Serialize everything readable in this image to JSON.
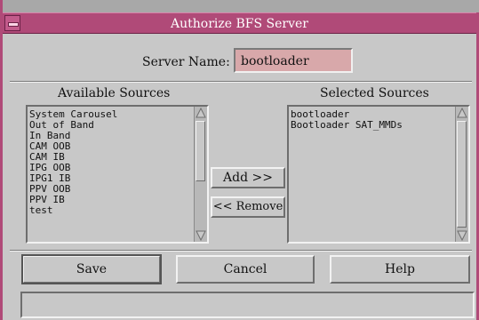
{
  "window": {
    "title": "Authorize BFS Server"
  },
  "server": {
    "label": "Server Name:",
    "value": "bootloader"
  },
  "available": {
    "label": "Available Sources",
    "items": [
      "System Carousel",
      "Out of Band",
      "In Band",
      "CAM OOB",
      "CAM IB",
      "IPG OOB",
      "IPG1 IB",
      "PPV OOB",
      "PPV IB",
      "test"
    ]
  },
  "selected": {
    "label": "Selected Sources",
    "items": [
      "bootloader",
      "Bootloader SAT_MMDs"
    ]
  },
  "transfer": {
    "add_label": "Add >>",
    "remove_label": "<< Remove"
  },
  "actions": {
    "save_label": "Save",
    "cancel_label": "Cancel",
    "help_label": "Help"
  },
  "colors": {
    "titlebar": "#b04a78",
    "input_bg": "#d8a8aa",
    "dialog_bg": "#c8c8c8"
  },
  "icons": [
    "window-menu-icon",
    "scroll-up-arrow-icon",
    "scroll-down-arrow-icon"
  ]
}
